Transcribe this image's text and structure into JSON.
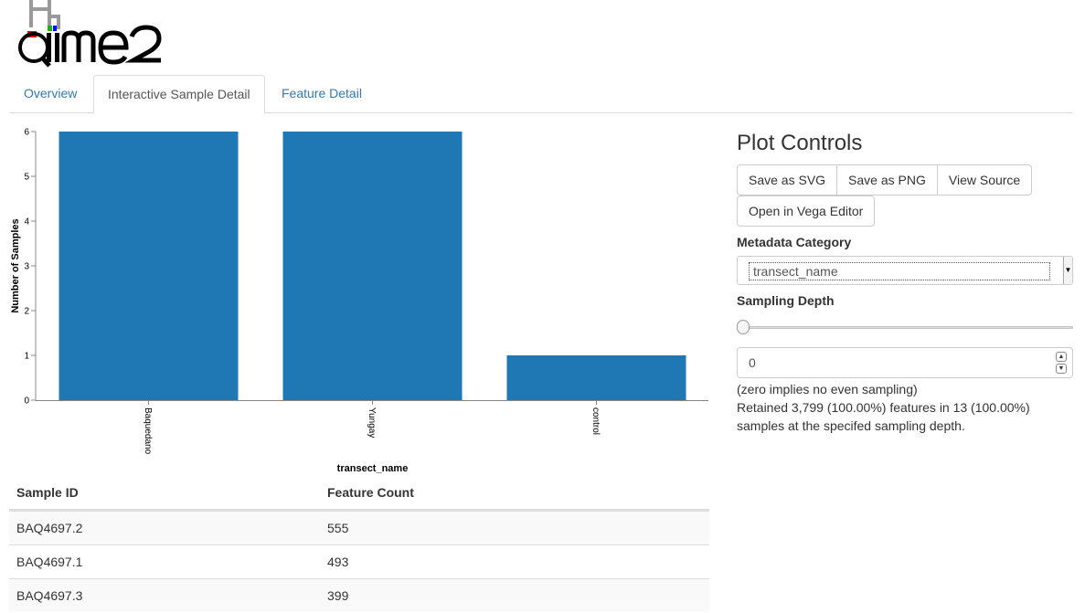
{
  "tabs": [
    {
      "label": "Overview"
    },
    {
      "label": "Interactive Sample Detail"
    },
    {
      "label": "Feature Detail"
    }
  ],
  "colors": {
    "bar": "#1f77b4",
    "link": "#337ab7"
  },
  "chart_data": {
    "type": "bar",
    "categories": [
      "Baquedano",
      "Yungay",
      "control"
    ],
    "values": [
      6,
      6,
      1
    ],
    "xlabel": "transect_name",
    "ylabel": "Number of Samples",
    "ylim": [
      0,
      6
    ],
    "yticks": [
      0,
      1,
      2,
      3,
      4,
      5,
      6
    ],
    "grid": false
  },
  "controls": {
    "title": "Plot Controls",
    "buttons": [
      "Save as SVG",
      "Save as PNG",
      "View Source"
    ],
    "vega_button": "Open in Vega Editor",
    "metadata_label": "Metadata Category",
    "metadata_value": "transect_name",
    "depth_label": "Sampling Depth",
    "depth_value": "0",
    "help_line1": "(zero implies no even sampling)",
    "help_line2": "Retained 3,799 (100.00%) features in 13 (100.00%) samples at the specifed sampling depth."
  },
  "table": {
    "headers": [
      "Sample ID",
      "Feature Count"
    ],
    "rows": [
      [
        "BAQ4697.2",
        "555"
      ],
      [
        "BAQ4697.1",
        "493"
      ],
      [
        "BAQ4697.3",
        "399"
      ]
    ]
  }
}
